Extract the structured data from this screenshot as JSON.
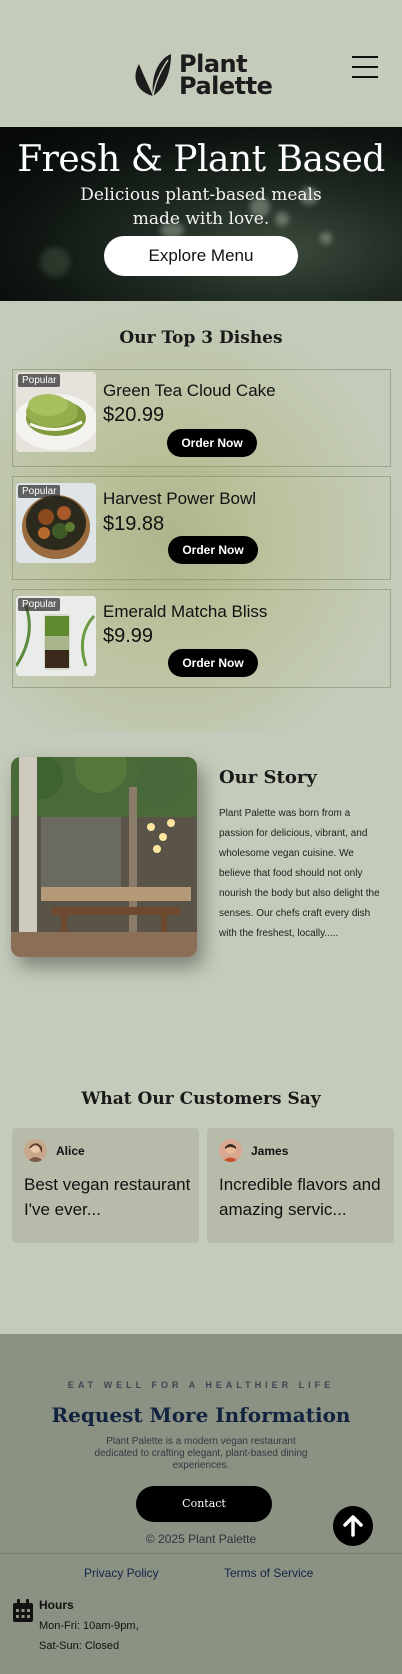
{
  "brand": {
    "name_line1": "Plant",
    "name_line2": "Palette"
  },
  "hero": {
    "title": "Fresh & Plant Based",
    "subtitle": "Delicious plant-based meals made with love.",
    "cta": "Explore Menu"
  },
  "dishes": {
    "title": "Our Top 3 Dishes",
    "items": [
      {
        "badge": "Popular",
        "name": "Green Tea Cloud Cake",
        "price": "$20.99",
        "cta": "Order Now"
      },
      {
        "badge": "Popular",
        "name": "Harvest Power Bowl",
        "price": "$19.88",
        "cta": "Order Now"
      },
      {
        "badge": "Popular",
        "name": "Emerald Matcha Bliss",
        "price": "$9.99",
        "cta": "Order Now"
      }
    ]
  },
  "story": {
    "title": "Our Story",
    "text": "Plant Palette was born from a passion for delicious, vibrant, and wholesome vegan cuisine. We believe that food should not only nourish the body but also delight the senses. Our chefs craft every dish with the freshest, locally....."
  },
  "testimonials": {
    "title": "What Our Customers Say",
    "items": [
      {
        "name": "Alice",
        "quote": "Best vegan restaurant I've ever..."
      },
      {
        "name": "James",
        "quote": "Incredible flavors and amazing servic..."
      }
    ]
  },
  "footer": {
    "tagline": "EAT WELL FOR A HEALTHIER LIFE",
    "title": "Request More Information",
    "description": "Plant Palette is a modern vegan restaurant dedicated to crafting elegant, plant-based dining experiences.",
    "contact": "Contact",
    "copyright": "© 2025 Plant Palette",
    "links": {
      "privacy": "Privacy Policy",
      "terms": "Terms of Service"
    },
    "hours": {
      "title": "Hours",
      "weekdays": "Mon-Fri: 10am-9pm,",
      "weekend": "Sat-Sun: Closed"
    }
  }
}
